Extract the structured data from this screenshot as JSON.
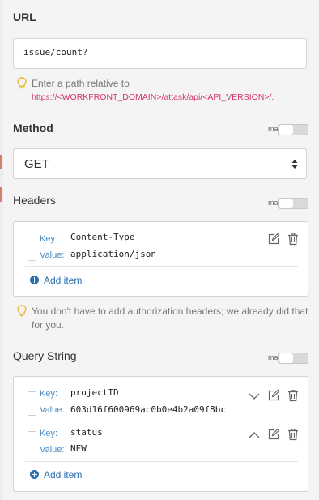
{
  "url_section": {
    "title": "URL",
    "value": "issue/count?",
    "hint_text": "Enter a path relative to",
    "hint_link": "https://<WORKFRONT_DOMAIN>/attask/api/<API_VERSION>/."
  },
  "method_section": {
    "title": "Method",
    "map_label": "map:",
    "selected": "GET"
  },
  "headers_section": {
    "title": "Headers",
    "map_label": "map:",
    "items": [
      {
        "key_label": "Key:",
        "key": "Content-Type",
        "value_label": "Value:",
        "value": "application/json"
      }
    ],
    "add_item": "Add item",
    "hint_text": "You don't have to add authorization headers; we already did that for you."
  },
  "query_section": {
    "title": "Query String",
    "map_label": "map:",
    "items": [
      {
        "key_label": "Key:",
        "key": "projectID",
        "value_label": "Value:",
        "value": "603d16f600969ac0b0e4b2a09f8bc"
      },
      {
        "key_label": "Key:",
        "key": "status",
        "value_label": "Value:",
        "value": "NEW"
      }
    ],
    "add_item": "Add item"
  },
  "icons": {
    "hint": "lightbulb-icon",
    "edit": "edit-icon",
    "delete": "trash-icon",
    "expand": "chevron-down-icon",
    "collapse": "chevron-up-icon",
    "add": "plus-circle-icon",
    "select_arrows": "sort-arrows-icon"
  },
  "colors": {
    "link": "#d5336d",
    "accent": "#2a6fb0",
    "key_label": "#4a8bc4",
    "hint_icon": "#e8b830"
  }
}
